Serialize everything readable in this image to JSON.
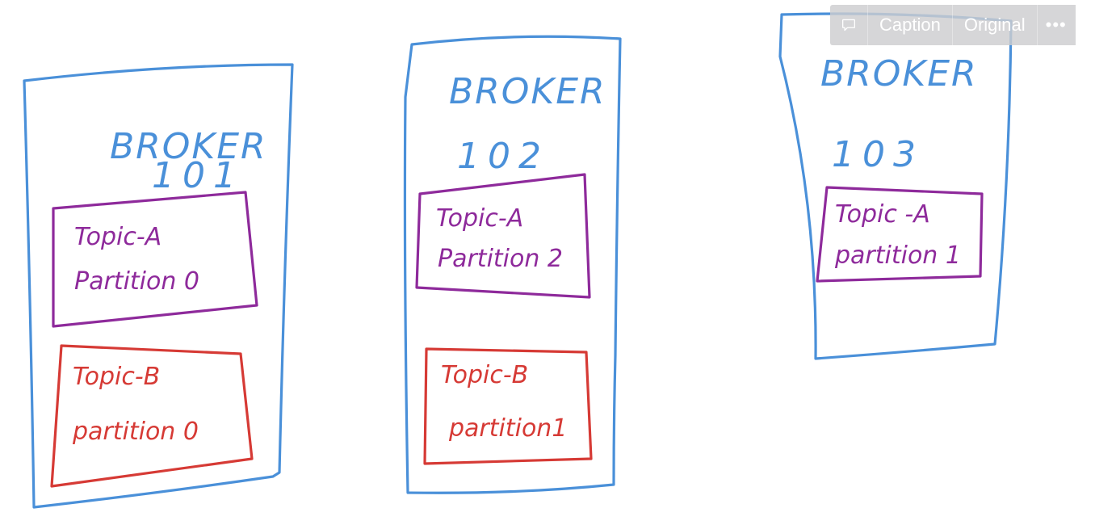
{
  "colors": {
    "broker": "#4a90d9",
    "topic_a": "#8e2a9b",
    "topic_b": "#d63a35"
  },
  "toolbar": {
    "comment_icon": "speech-bubble-icon",
    "caption_label": "Caption",
    "original_label": "Original",
    "more_label": "•••"
  },
  "brokers": [
    {
      "title": "BROKER",
      "number": "101",
      "partitions": [
        {
          "topic": "Topic-A",
          "partition": "Partition 0",
          "color": "#8e2a9b"
        },
        {
          "topic": "Topic-B",
          "partition": "partition 0",
          "color": "#d63a35"
        }
      ]
    },
    {
      "title": "BROKER",
      "number": "102",
      "partitions": [
        {
          "topic": "Topic-A",
          "partition": "Partition 2",
          "color": "#8e2a9b"
        },
        {
          "topic": "Topic-B",
          "partition": "partition1",
          "color": "#d63a35"
        }
      ]
    },
    {
      "title": "BROKER",
      "number": "103",
      "partitions": [
        {
          "topic": "Topic -A",
          "partition": "partition 1",
          "color": "#8e2a9b"
        }
      ]
    }
  ]
}
